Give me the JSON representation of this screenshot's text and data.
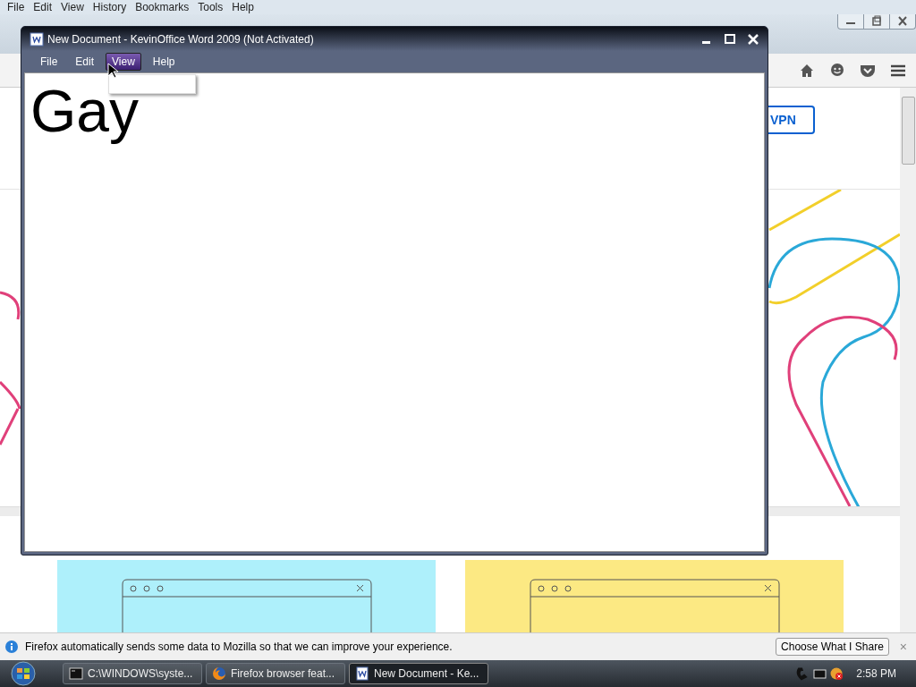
{
  "browser": {
    "menu": [
      "File",
      "Edit",
      "View",
      "History",
      "Bookmarks",
      "Tools",
      "Help"
    ],
    "vpn_button": "VPN",
    "notification": {
      "text": "Firefox automatically sends some data to Mozilla so that we can improve your experience.",
      "button": "Choose What I Share",
      "close": "×"
    }
  },
  "word_window": {
    "title": "New Document - KevinOffice Word 2009 (Not Activated)",
    "menu": [
      {
        "label": "File",
        "selected": false
      },
      {
        "label": "Edit",
        "selected": false
      },
      {
        "label": "View",
        "selected": true
      },
      {
        "label": "Help",
        "selected": false
      }
    ],
    "document_text": "Gay"
  },
  "taskbar": {
    "items": [
      {
        "label": "C:\\WINDOWS\\syste...",
        "selected": false,
        "kind": "console"
      },
      {
        "label": "Firefox browser feat...",
        "selected": false,
        "kind": "firefox"
      },
      {
        "label": "New Document - Ke...",
        "selected": true,
        "kind": "word"
      }
    ],
    "clock": "2:58 PM"
  }
}
